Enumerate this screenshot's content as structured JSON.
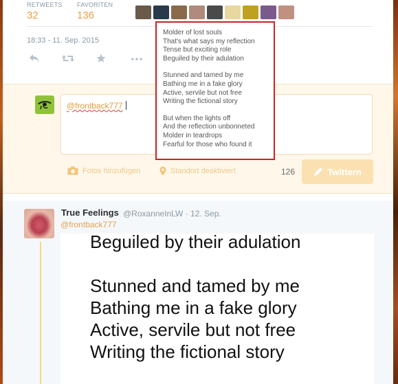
{
  "stats": {
    "retweets_label": "RETWEETS",
    "retweets_count": "32",
    "favorites_label": "FAVORITEN",
    "favorites_count": "136"
  },
  "avatar_colors": [
    "#6a5a4a",
    "#2a3a4a",
    "#8a6a4a",
    "#b08a7a",
    "#4a4a4a",
    "#e8d8a0",
    "#c0a020",
    "#7a5a8a",
    "#c09080"
  ],
  "tweet_meta": {
    "timestamp": "18:33 - 11. Sep. 2015"
  },
  "action_icons": [
    "reply-icon",
    "retweet-icon",
    "favorite-icon",
    "more-icon"
  ],
  "compose": {
    "text": "@frontback777",
    "photo_label": "Fotos hinzufügen",
    "location_label": "Standort deaktiviert",
    "counter": "126",
    "tweet_button": "Twittern"
  },
  "tooltip": {
    "stanza1": [
      "Molder of lost souls",
      "That's what says my reflection",
      "Tense but exciting role",
      "Beguiled by their adulation"
    ],
    "stanza2": [
      "Stunned and tamed by me",
      "Bathing me in a fake glory",
      "Active, servile but not free",
      "Writing the fictional story"
    ],
    "stanza3": [
      "But when the lights off",
      "And the reflection unbonneted",
      "Molder in teardrops",
      "Fearful for those who found it"
    ]
  },
  "reply_tweet": {
    "name": "True Feelings",
    "handle_date": "@RoxanneInLW · 12. Sep.",
    "reply_to": "@frontback777",
    "image_lines": [
      "Beguiled by their adulation",
      "",
      "Stunned and tamed by me",
      "Bathing me in a fake glory",
      "Active, servile but not free",
      "Writing the fictional story"
    ]
  },
  "colors": {
    "accent": "#e8a04a",
    "highlight_border": "#cc2222",
    "compose_bg": "#fef7ea"
  }
}
